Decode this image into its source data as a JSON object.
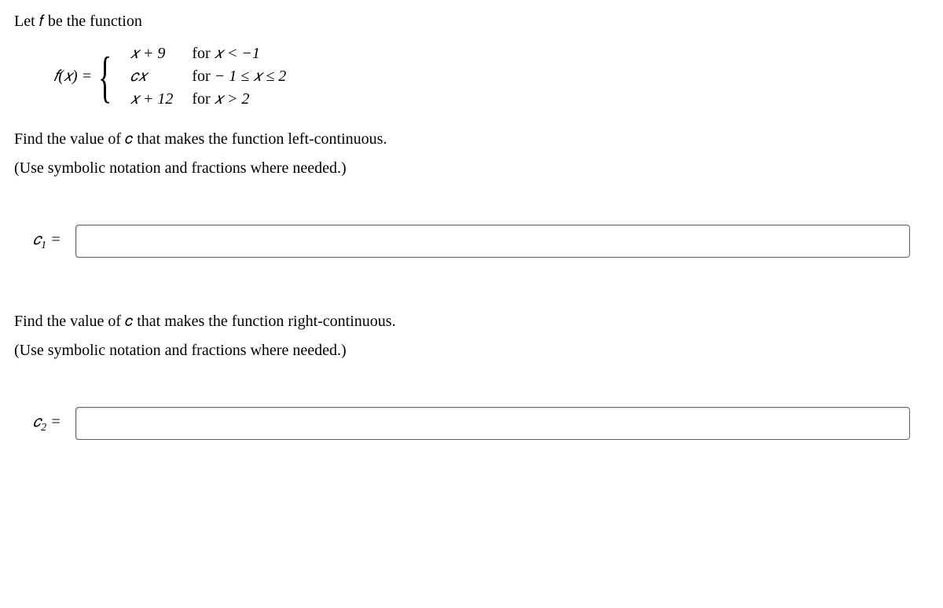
{
  "intro": "Let 𝑓 be the function",
  "func": {
    "lhs": "𝑓(𝑥) =",
    "cases": [
      {
        "expr": "𝑥 + 9",
        "cond_pre": "for ",
        "cond_math": "𝑥 < −1"
      },
      {
        "expr": "𝑐𝑥",
        "cond_pre": "for ",
        "cond_math": "− 1 ≤ 𝑥 ≤ 2"
      },
      {
        "expr": "𝑥 + 12",
        "cond_pre": "for ",
        "cond_math": "𝑥 > 2"
      }
    ]
  },
  "q1": {
    "prompt": "Find the value of 𝑐 that makes the function left-continuous.",
    "hint": "(Use symbolic notation and fractions where needed.)",
    "label_var": "𝑐",
    "label_sub": "1",
    "label_eq": " ="
  },
  "q2": {
    "prompt": "Find the value of 𝑐 that makes the function right-continuous.",
    "hint": "(Use symbolic notation and fractions where needed.)",
    "label_var": "𝑐",
    "label_sub": "2",
    "label_eq": " ="
  }
}
